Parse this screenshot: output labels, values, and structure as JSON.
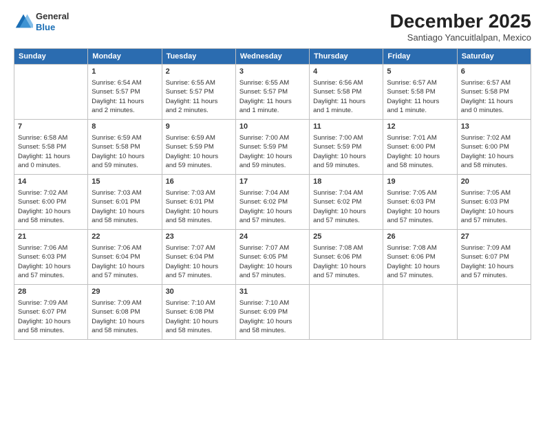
{
  "logo": {
    "general": "General",
    "blue": "Blue"
  },
  "header": {
    "month": "December 2025",
    "location": "Santiago Yancuitlalpan, Mexico"
  },
  "weekdays": [
    "Sunday",
    "Monday",
    "Tuesday",
    "Wednesday",
    "Thursday",
    "Friday",
    "Saturday"
  ],
  "weeks": [
    [
      {
        "day": "",
        "info": ""
      },
      {
        "day": "1",
        "info": "Sunrise: 6:54 AM\nSunset: 5:57 PM\nDaylight: 11 hours\nand 2 minutes."
      },
      {
        "day": "2",
        "info": "Sunrise: 6:55 AM\nSunset: 5:57 PM\nDaylight: 11 hours\nand 2 minutes."
      },
      {
        "day": "3",
        "info": "Sunrise: 6:55 AM\nSunset: 5:57 PM\nDaylight: 11 hours\nand 1 minute."
      },
      {
        "day": "4",
        "info": "Sunrise: 6:56 AM\nSunset: 5:58 PM\nDaylight: 11 hours\nand 1 minute."
      },
      {
        "day": "5",
        "info": "Sunrise: 6:57 AM\nSunset: 5:58 PM\nDaylight: 11 hours\nand 1 minute."
      },
      {
        "day": "6",
        "info": "Sunrise: 6:57 AM\nSunset: 5:58 PM\nDaylight: 11 hours\nand 0 minutes."
      }
    ],
    [
      {
        "day": "7",
        "info": "Sunrise: 6:58 AM\nSunset: 5:58 PM\nDaylight: 11 hours\nand 0 minutes."
      },
      {
        "day": "8",
        "info": "Sunrise: 6:59 AM\nSunset: 5:58 PM\nDaylight: 10 hours\nand 59 minutes."
      },
      {
        "day": "9",
        "info": "Sunrise: 6:59 AM\nSunset: 5:59 PM\nDaylight: 10 hours\nand 59 minutes."
      },
      {
        "day": "10",
        "info": "Sunrise: 7:00 AM\nSunset: 5:59 PM\nDaylight: 10 hours\nand 59 minutes."
      },
      {
        "day": "11",
        "info": "Sunrise: 7:00 AM\nSunset: 5:59 PM\nDaylight: 10 hours\nand 59 minutes."
      },
      {
        "day": "12",
        "info": "Sunrise: 7:01 AM\nSunset: 6:00 PM\nDaylight: 10 hours\nand 58 minutes."
      },
      {
        "day": "13",
        "info": "Sunrise: 7:02 AM\nSunset: 6:00 PM\nDaylight: 10 hours\nand 58 minutes."
      }
    ],
    [
      {
        "day": "14",
        "info": "Sunrise: 7:02 AM\nSunset: 6:00 PM\nDaylight: 10 hours\nand 58 minutes."
      },
      {
        "day": "15",
        "info": "Sunrise: 7:03 AM\nSunset: 6:01 PM\nDaylight: 10 hours\nand 58 minutes."
      },
      {
        "day": "16",
        "info": "Sunrise: 7:03 AM\nSunset: 6:01 PM\nDaylight: 10 hours\nand 58 minutes."
      },
      {
        "day": "17",
        "info": "Sunrise: 7:04 AM\nSunset: 6:02 PM\nDaylight: 10 hours\nand 57 minutes."
      },
      {
        "day": "18",
        "info": "Sunrise: 7:04 AM\nSunset: 6:02 PM\nDaylight: 10 hours\nand 57 minutes."
      },
      {
        "day": "19",
        "info": "Sunrise: 7:05 AM\nSunset: 6:03 PM\nDaylight: 10 hours\nand 57 minutes."
      },
      {
        "day": "20",
        "info": "Sunrise: 7:05 AM\nSunset: 6:03 PM\nDaylight: 10 hours\nand 57 minutes."
      }
    ],
    [
      {
        "day": "21",
        "info": "Sunrise: 7:06 AM\nSunset: 6:03 PM\nDaylight: 10 hours\nand 57 minutes."
      },
      {
        "day": "22",
        "info": "Sunrise: 7:06 AM\nSunset: 6:04 PM\nDaylight: 10 hours\nand 57 minutes."
      },
      {
        "day": "23",
        "info": "Sunrise: 7:07 AM\nSunset: 6:04 PM\nDaylight: 10 hours\nand 57 minutes."
      },
      {
        "day": "24",
        "info": "Sunrise: 7:07 AM\nSunset: 6:05 PM\nDaylight: 10 hours\nand 57 minutes."
      },
      {
        "day": "25",
        "info": "Sunrise: 7:08 AM\nSunset: 6:06 PM\nDaylight: 10 hours\nand 57 minutes."
      },
      {
        "day": "26",
        "info": "Sunrise: 7:08 AM\nSunset: 6:06 PM\nDaylight: 10 hours\nand 57 minutes."
      },
      {
        "day": "27",
        "info": "Sunrise: 7:09 AM\nSunset: 6:07 PM\nDaylight: 10 hours\nand 57 minutes."
      }
    ],
    [
      {
        "day": "28",
        "info": "Sunrise: 7:09 AM\nSunset: 6:07 PM\nDaylight: 10 hours\nand 58 minutes."
      },
      {
        "day": "29",
        "info": "Sunrise: 7:09 AM\nSunset: 6:08 PM\nDaylight: 10 hours\nand 58 minutes."
      },
      {
        "day": "30",
        "info": "Sunrise: 7:10 AM\nSunset: 6:08 PM\nDaylight: 10 hours\nand 58 minutes."
      },
      {
        "day": "31",
        "info": "Sunrise: 7:10 AM\nSunset: 6:09 PM\nDaylight: 10 hours\nand 58 minutes."
      },
      {
        "day": "",
        "info": ""
      },
      {
        "day": "",
        "info": ""
      },
      {
        "day": "",
        "info": ""
      }
    ]
  ]
}
